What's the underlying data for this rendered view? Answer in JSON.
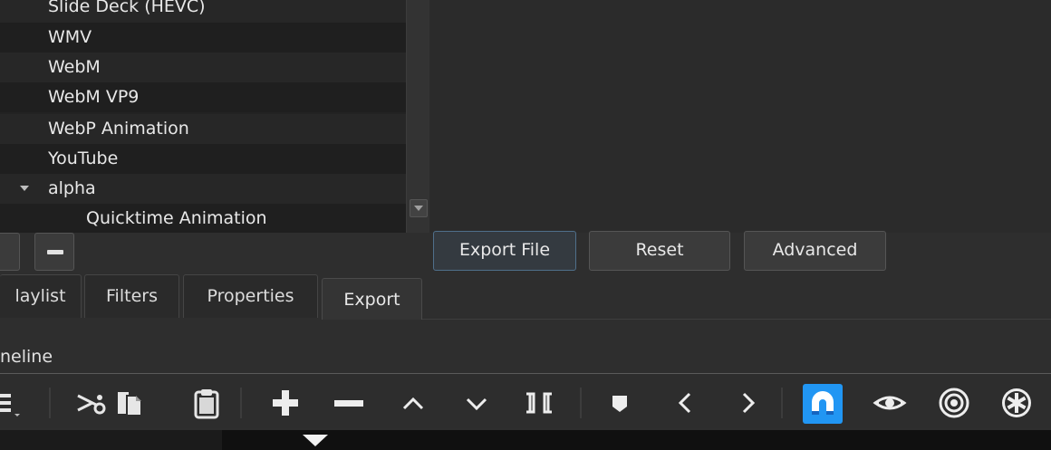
{
  "presets": {
    "items": [
      {
        "label": "Slide Deck (HEVC)",
        "indent": 53
      },
      {
        "label": "WMV",
        "indent": 53
      },
      {
        "label": "WebM",
        "indent": 53
      },
      {
        "label": "WebM VP9",
        "indent": 53
      },
      {
        "label": "WebP Animation",
        "indent": 53
      },
      {
        "label": "YouTube",
        "indent": 53
      },
      {
        "label": "alpha",
        "indent": 53,
        "expanded": true
      },
      {
        "label": "Quicktime Animation",
        "indent": 95
      }
    ]
  },
  "buttons": {
    "export_file": "Export File",
    "reset": "Reset",
    "advanced": "Advanced"
  },
  "tabs": [
    {
      "label": "laylist"
    },
    {
      "label": "Filters"
    },
    {
      "label": "Properties"
    },
    {
      "label": "Export",
      "active": true
    }
  ],
  "timeline": {
    "label": "neline"
  },
  "colors": {
    "accent": "#2196f3",
    "panel": "#2e2e2e",
    "list_bg": "#232323"
  },
  "toolbar_icons": [
    "timeline-menu-icon",
    "cut-icon",
    "copy-icon",
    "paste-icon",
    "append-icon",
    "remove-icon",
    "lift-icon",
    "overwrite-icon",
    "split-icon",
    "marker-icon",
    "previous-marker-icon",
    "next-marker-icon",
    "snap-magnet-icon",
    "scrub-drag-icon",
    "ripple-icon",
    "ripple-all-tracks-icon"
  ]
}
